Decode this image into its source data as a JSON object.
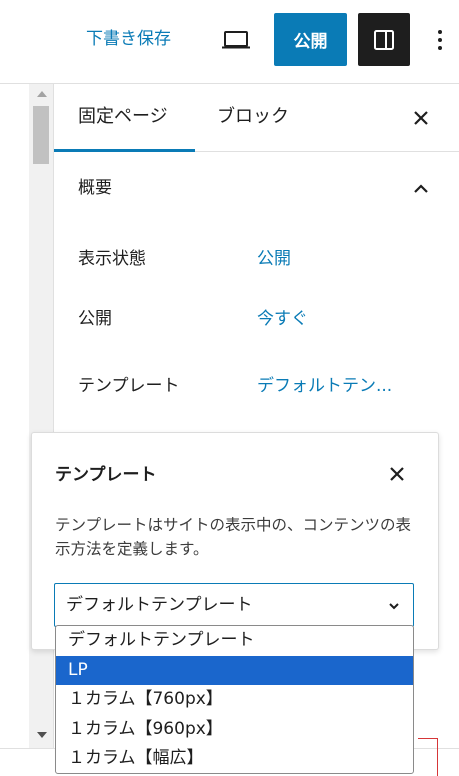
{
  "toolbar": {
    "save_draft_label": "下書き保存",
    "publish_label": "公開",
    "preview_icon": "laptop-icon",
    "settings_icon": "sidebar-toggle-icon",
    "more_icon": "more-vertical-icon"
  },
  "sidebar": {
    "tabs": [
      {
        "label": "固定ページ",
        "active": true
      },
      {
        "label": "ブロック",
        "active": false
      }
    ],
    "close_icon": "close-icon"
  },
  "summary": {
    "title": "概要",
    "rows": [
      {
        "label": "表示状態",
        "value": "公開"
      },
      {
        "label": "公開",
        "value": "今すぐ"
      },
      {
        "label": "テンプレート",
        "value": "デフォルトテン..."
      }
    ]
  },
  "template_popover": {
    "title": "テンプレート",
    "description": "テンプレートはサイトの表示中の、コンテンツの表示方法を定義します。",
    "selected_value": "デフォルトテンプレート",
    "options": [
      {
        "label": "デフォルトテンプレート",
        "highlighted": false
      },
      {
        "label": "LP",
        "highlighted": true
      },
      {
        "label": "１カラム【760px】",
        "highlighted": false
      },
      {
        "label": "１カラム【960px】",
        "highlighted": false
      },
      {
        "label": "１カラム【幅広】",
        "highlighted": false
      }
    ]
  },
  "colors": {
    "accent": "#0a7bb6",
    "highlight": "#1a66cc",
    "dark": "#1e1e1e"
  }
}
